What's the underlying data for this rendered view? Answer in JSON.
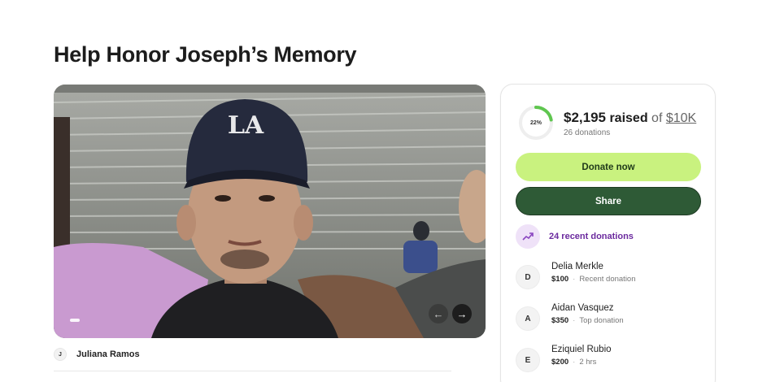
{
  "page": {
    "title": "Help Honor Joseph’s Memory"
  },
  "hero": {
    "cap_logo": "LA",
    "prev_icon": "arrow-left-icon",
    "next_icon": "arrow-right-icon"
  },
  "organizer": {
    "initial": "J",
    "name": "Juliana Ramos"
  },
  "card": {
    "progress_label": "22%",
    "progress_fraction": 0.22,
    "raised_amount": "$2,195",
    "raised_word": "raised",
    "of_word": "of",
    "goal": "$10K",
    "donation_count": "26 donations",
    "donate_label": "Donate now",
    "share_label": "Share",
    "recent_label": "24 recent donations",
    "recent_icon": "trending-up-icon",
    "donations": [
      {
        "initial": "D",
        "name": "Delia Merkle",
        "amount": "$100",
        "note": "Recent donation"
      },
      {
        "initial": "A",
        "name": "Aidan Vasquez",
        "amount": "$350",
        "note": "Top donation"
      },
      {
        "initial": "E",
        "name": "Eziquiel Rubio",
        "amount": "$200",
        "note": "2 hrs"
      }
    ]
  },
  "colors": {
    "accent_green": "#c9f27f",
    "dark_green": "#2e5a36",
    "purple": "#6b2a9e",
    "progress": "#5fc64f"
  }
}
